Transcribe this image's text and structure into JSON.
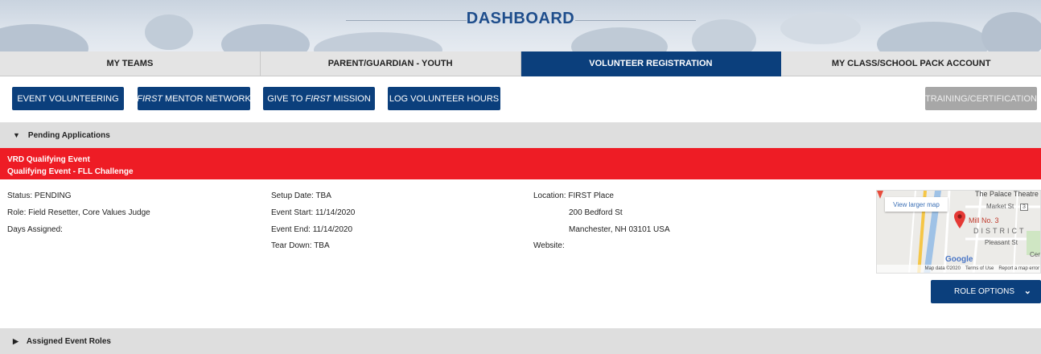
{
  "header": {
    "title": "DASHBOARD"
  },
  "tabs": [
    {
      "label": "MY TEAMS",
      "active": false
    },
    {
      "label": "PARENT/GUARDIAN - YOUTH",
      "active": false
    },
    {
      "label": "VOLUNTEER REGISTRATION",
      "active": true
    },
    {
      "label": "MY CLASS/SCHOOL PACK ACCOUNT",
      "active": false
    }
  ],
  "actions": {
    "event_volunteering": "EVENT VOLUNTEERING",
    "mentor_network": {
      "em": "FIRST",
      "rest": " MENTOR NETWORK"
    },
    "give_mission": {
      "pre": "GIVE TO ",
      "em": "FIRST",
      "post": " MISSION"
    },
    "log_hours": "LOG VOLUNTEER HOURS",
    "training": "TRAINING/CERTIFICATION"
  },
  "sections": {
    "pending": "Pending Applications",
    "assigned": "Assigned Event Roles"
  },
  "event": {
    "title": "VRD Qualifying Event",
    "subtitle": "Qualifying Event - FLL Challenge",
    "status_label": "Status:",
    "status": "PENDING",
    "role_label": "Role:",
    "role": "Field Resetter, Core Values Judge",
    "days_label": "Days Assigned:",
    "setup_label": "Setup Date",
    "setup": "TBA",
    "start_label": "Event Start:",
    "start": "11/14/2020",
    "end_label": "Event End:",
    "end": "11/14/2020",
    "teardown_label": "Tear Down:",
    "teardown": "TBA",
    "location_label": "Location:",
    "location_name": "FIRST Place",
    "address1": "200 Bedford St",
    "address2": "Manchester, NH 03101 USA",
    "website_label": "Website:"
  },
  "map": {
    "view_larger": "View larger map",
    "palace": "The Palace Theatre",
    "market": "Market St",
    "mill": "Mill No. 3",
    "district": "DISTRICT",
    "pleasant": "Pleasant St",
    "cent": "Cent",
    "google": "Google",
    "map_data": "Map data ©2020",
    "terms": "Terms of Use",
    "report": "Report a map error",
    "shield": "3"
  },
  "role_options": "ROLE OPTIONS",
  "colors": {
    "primary": "#0b3f7c",
    "event_red": "#ee1c25",
    "tab_bg": "#e4e4e4",
    "disabled": "#a7a7a7"
  }
}
